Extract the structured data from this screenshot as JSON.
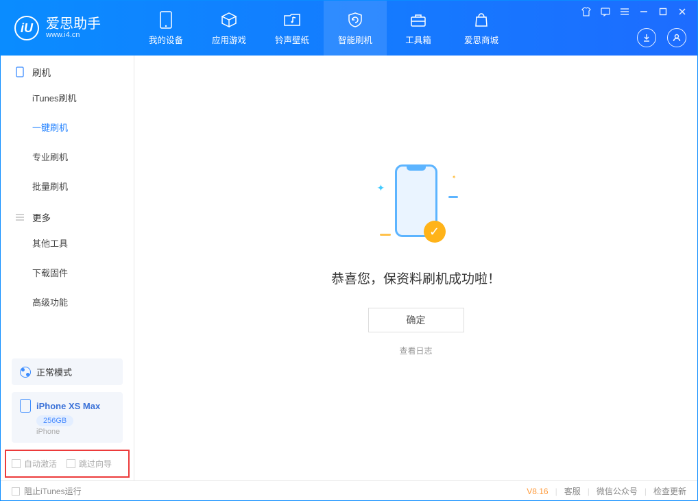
{
  "app": {
    "name": "爱思助手",
    "website": "www.i4.cn",
    "logo_letter": "iU"
  },
  "header_tabs": [
    {
      "label": "我的设备"
    },
    {
      "label": "应用游戏"
    },
    {
      "label": "铃声壁纸"
    },
    {
      "label": "智能刷机"
    },
    {
      "label": "工具箱"
    },
    {
      "label": "爱思商城"
    }
  ],
  "sidebar": {
    "group1_title": "刷机",
    "group1_items": [
      {
        "label": "iTunes刷机"
      },
      {
        "label": "一键刷机"
      },
      {
        "label": "专业刷机"
      },
      {
        "label": "批量刷机"
      }
    ],
    "group2_title": "更多",
    "group2_items": [
      {
        "label": "其他工具"
      },
      {
        "label": "下载固件"
      },
      {
        "label": "高级功能"
      }
    ]
  },
  "mode": {
    "label": "正常模式"
  },
  "device": {
    "name": "iPhone XS Max",
    "capacity": "256GB",
    "type": "iPhone"
  },
  "bottom_options": {
    "auto_activate": "自动激活",
    "skip_guide": "跳过向导"
  },
  "main": {
    "success_text": "恭喜您，保资料刷机成功啦！",
    "ok_button": "确定",
    "view_log": "查看日志"
  },
  "statusbar": {
    "block_itunes": "阻止iTunes运行",
    "version": "V8.16",
    "customer_service": "客服",
    "wechat": "微信公众号",
    "check_update": "检查更新"
  }
}
